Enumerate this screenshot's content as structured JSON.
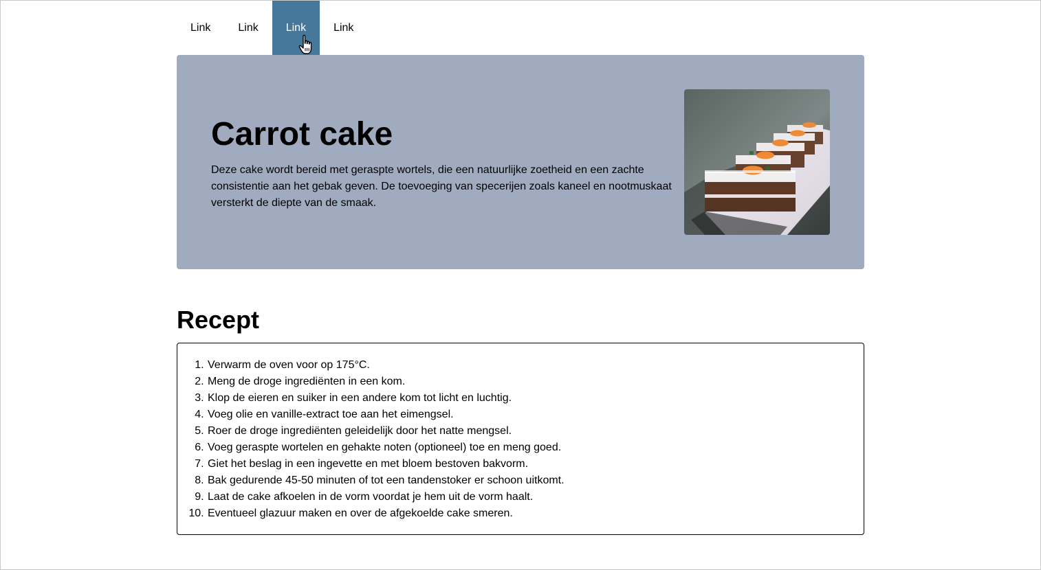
{
  "nav": {
    "links": [
      "Link",
      "Link",
      "Link",
      "Link"
    ],
    "active_index": 2
  },
  "hero": {
    "title": "Carrot cake",
    "description": "Deze cake wordt bereid met geraspte wortels, die een natuurlijke zoetheid en een zachte consistentie aan het gebak geven. De toevoeging van specerijen zoals kaneel en nootmuskaat versterkt de diepte van de smaak.",
    "image_icon": "carrot-cake-photo",
    "background_color": "#a0abbf"
  },
  "recipe": {
    "title": "Recept",
    "steps": [
      "Verwarm de oven voor op 175°C.",
      "Meng de droge ingrediënten in een kom.",
      "Klop de eieren en suiker in een andere kom tot licht en luchtig.",
      "Voeg olie en vanille-extract toe aan het eimengsel.",
      "Roer de droge ingrediënten geleidelijk door het natte mengsel.",
      "Voeg geraspte wortelen en gehakte noten (optioneel) toe en meng goed.",
      "Giet het beslag in een ingevette en met bloem bestoven bakvorm.",
      "Bak gedurende 45-50 minuten of tot een tandenstoker er schoon uitkomt.",
      "Laat de cake afkoelen in de vorm voordat je hem uit de vorm haalt.",
      "Eventueel glazuur maken en over de afgekoelde cake smeren."
    ]
  },
  "colors": {
    "nav_active": "#46789c",
    "hero_bg": "#a0abbf"
  }
}
